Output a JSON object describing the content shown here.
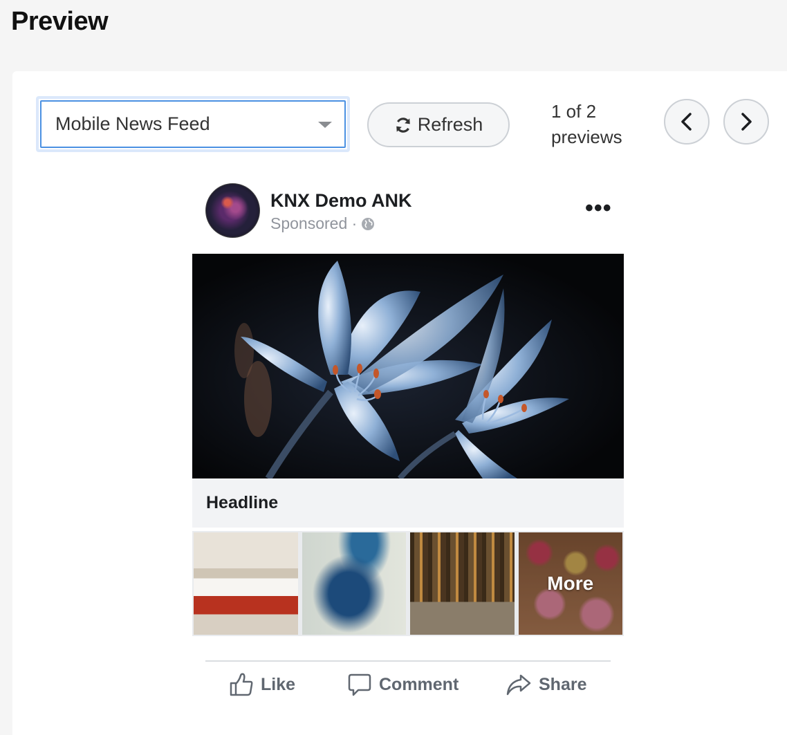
{
  "header": {
    "title": "Preview"
  },
  "toolbar": {
    "placement_select": {
      "value": "Mobile News Feed"
    },
    "refresh_label": "Refresh",
    "preview_count": {
      "line1": "1 of 2",
      "line2": "previews"
    },
    "prev_icon": "chevron-left-icon",
    "next_icon": "chevron-right-icon"
  },
  "post": {
    "page_name": "KNX Demo ANK",
    "sponsored_label": "Sponsored ·",
    "privacy_icon": "globe-icon",
    "more_label": "•••",
    "hero_image": "blue-flower-image",
    "headline": "Headline",
    "thumbnails": [
      {
        "image": "hotel-bedroom-image"
      },
      {
        "image": "peacock-image"
      },
      {
        "image": "forest-road-image"
      },
      {
        "image": "pastries-image",
        "overlay_label": "More"
      }
    ],
    "actions": {
      "like": "Like",
      "comment": "Comment",
      "share": "Share"
    }
  },
  "colors": {
    "select_border": "#4a90e2",
    "muted_text": "#90949c",
    "action_text": "#606770",
    "headline_bg": "#f2f3f5"
  }
}
